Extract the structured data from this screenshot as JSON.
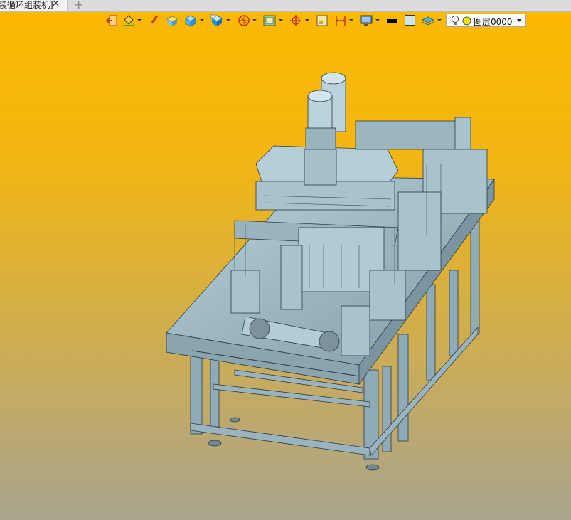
{
  "tab": {
    "title": "装循环组装机]",
    "close_glyph": "✕",
    "add_glyph": "+"
  },
  "toolbar": {
    "icons": [
      "exit-icon",
      "paint-bucket-icon",
      "brush-icon",
      "solid-icon",
      "box-icon",
      "shaded-box-icon",
      "sphere-wire-icon",
      "image-frame-icon",
      "target-icon",
      "region-icon",
      "dimension-icon",
      "monitor-icon",
      "line-color-swatch",
      "fill-color-swatch",
      "layers-icon"
    ],
    "line_color": "#000000",
    "fill_color": "#c9e6f5"
  },
  "layer": {
    "label": "图层0000",
    "bulb_color": "#ffffff",
    "dot_color": "#e8e800"
  },
  "viewport": {
    "background_top": "#fdb900",
    "background_bottom": "#a9a58e",
    "model_color": "#9db8c4"
  }
}
